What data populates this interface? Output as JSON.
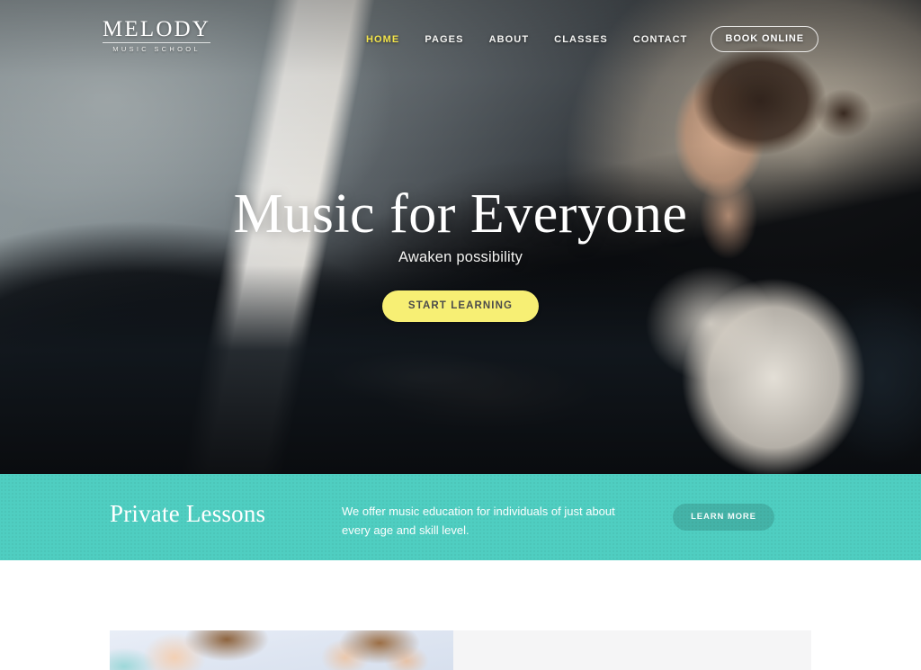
{
  "brand": {
    "name": "MELODY",
    "tagline": "MUSIC SCHOOL"
  },
  "nav": {
    "items": [
      {
        "label": "HOME",
        "active": true
      },
      {
        "label": "PAGES",
        "active": false
      },
      {
        "label": "ABOUT",
        "active": false
      },
      {
        "label": "CLASSES",
        "active": false
      },
      {
        "label": "CONTACT",
        "active": false
      }
    ],
    "cta_label": "BOOK ONLINE",
    "active_color": "#f2e34a"
  },
  "hero": {
    "title": "Music for Everyone",
    "subtitle": "Awaken possibility",
    "button_label": "START LEARNING",
    "button_color": "#f7ef74",
    "button_text_color": "#4b4b4b"
  },
  "band": {
    "title": "Private Lessons",
    "text": "We offer music education for individuals of just about every age and skill level.",
    "button_label": "LEARN MORE",
    "background_color": "#4fcec1"
  },
  "lower": {
    "card_image_alt": "two-children-smiling-photo",
    "panel_color": "#f5f5f6"
  }
}
